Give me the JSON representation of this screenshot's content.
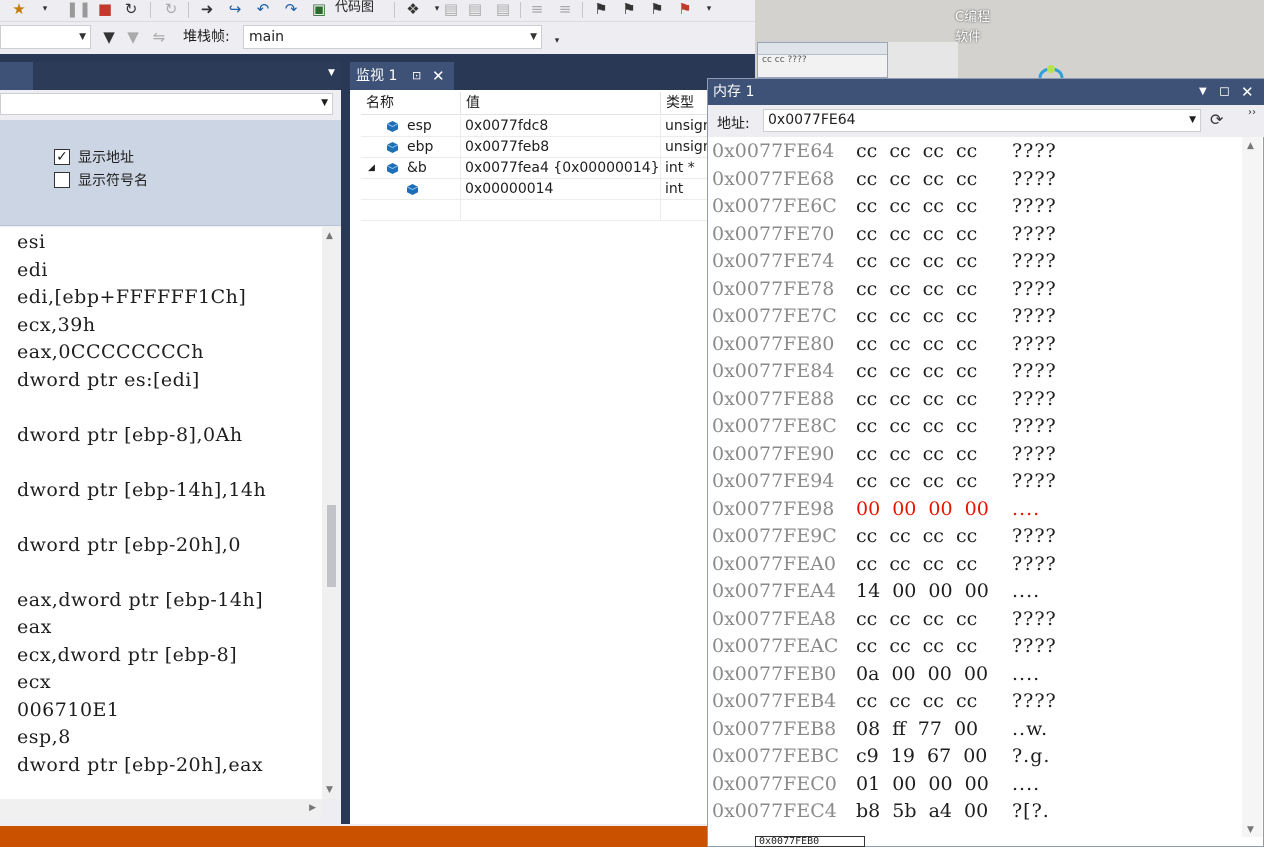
{
  "toolbar": {
    "codemap_label": "代码图"
  },
  "stackframe": {
    "label": "堆栈帧:",
    "value": "main"
  },
  "options": {
    "show_address": {
      "label": "显示地址",
      "checked": true
    },
    "show_symbol_names": {
      "label": "显示符号名",
      "checked": false
    }
  },
  "disassembly": {
    "lines": [
      "esi",
      "edi",
      "edi,[ebp+FFFFFF1Ch]",
      "ecx,39h",
      "eax,0CCCCCCCCh",
      "dword ptr es:[edi]",
      "",
      "dword ptr [ebp-8],0Ah",
      "",
      "dword ptr [ebp-14h],14h",
      "",
      "dword ptr [ebp-20h],0",
      "",
      "eax,dword ptr [ebp-14h]",
      "eax",
      "ecx,dword ptr [ebp-8]",
      "ecx",
      "006710E1",
      "esp,8",
      "dword ptr [ebp-20h],eax"
    ]
  },
  "watch": {
    "tab_label": "监视 1",
    "columns": {
      "name": "名称",
      "value": "值",
      "type": "类型"
    },
    "rows": [
      {
        "name": "esp",
        "value": "0x0077fdc8",
        "type": "unsign"
      },
      {
        "name": "ebp",
        "value": "0x0077feb8",
        "type": "unsign"
      },
      {
        "name": "&b",
        "value": "0x0077fea4 {0x00000014}",
        "type": "int *"
      },
      {
        "name": "",
        "value": "0x00000014",
        "type": "int"
      }
    ]
  },
  "memory": {
    "title": "内存 1",
    "address_label": "地址:",
    "address_value": "0x0077FE64",
    "rows": [
      {
        "addr": "0x0077FE64",
        "bytes": "cc cc cc cc",
        "text": "????",
        "changed": false
      },
      {
        "addr": "0x0077FE68",
        "bytes": "cc cc cc cc",
        "text": "????",
        "changed": false
      },
      {
        "addr": "0x0077FE6C",
        "bytes": "cc cc cc cc",
        "text": "????",
        "changed": false
      },
      {
        "addr": "0x0077FE70",
        "bytes": "cc cc cc cc",
        "text": "????",
        "changed": false
      },
      {
        "addr": "0x0077FE74",
        "bytes": "cc cc cc cc",
        "text": "????",
        "changed": false
      },
      {
        "addr": "0x0077FE78",
        "bytes": "cc cc cc cc",
        "text": "????",
        "changed": false
      },
      {
        "addr": "0x0077FE7C",
        "bytes": "cc cc cc cc",
        "text": "????",
        "changed": false
      },
      {
        "addr": "0x0077FE80",
        "bytes": "cc cc cc cc",
        "text": "????",
        "changed": false
      },
      {
        "addr": "0x0077FE84",
        "bytes": "cc cc cc cc",
        "text": "????",
        "changed": false
      },
      {
        "addr": "0x0077FE88",
        "bytes": "cc cc cc cc",
        "text": "????",
        "changed": false
      },
      {
        "addr": "0x0077FE8C",
        "bytes": "cc cc cc cc",
        "text": "????",
        "changed": false
      },
      {
        "addr": "0x0077FE90",
        "bytes": "cc cc cc cc",
        "text": "????",
        "changed": false
      },
      {
        "addr": "0x0077FE94",
        "bytes": "cc cc cc cc",
        "text": "????",
        "changed": false
      },
      {
        "addr": "0x0077FE98",
        "bytes": "00 00 00 00",
        "text": "....",
        "changed": true
      },
      {
        "addr": "0x0077FE9C",
        "bytes": "cc cc cc cc",
        "text": "????",
        "changed": false
      },
      {
        "addr": "0x0077FEA0",
        "bytes": "cc cc cc cc",
        "text": "????",
        "changed": false
      },
      {
        "addr": "0x0077FEA4",
        "bytes": "14 00 00 00",
        "text": "....",
        "changed": false
      },
      {
        "addr": "0x0077FEA8",
        "bytes": "cc cc cc cc",
        "text": "????",
        "changed": false
      },
      {
        "addr": "0x0077FEAC",
        "bytes": "cc cc cc cc",
        "text": "????",
        "changed": false
      },
      {
        "addr": "0x0077FEB0",
        "bytes": "0a 00 00 00",
        "text": "....",
        "changed": false
      },
      {
        "addr": "0x0077FEB4",
        "bytes": "cc cc cc cc",
        "text": "????",
        "changed": false
      },
      {
        "addr": "0x0077FEB8",
        "bytes": "08 ff 77 00",
        "text": "..w.",
        "changed": false
      },
      {
        "addr": "0x0077FEBC",
        "bytes": "c9 19 67 00",
        "text": "?.g.",
        "changed": false
      },
      {
        "addr": "0x0077FEC0",
        "bytes": "01 00 00 00",
        "text": "....",
        "changed": false
      },
      {
        "addr": "0x0077FEC4",
        "bytes": "b8 5b a4 00",
        "text": "?[?.",
        "changed": false
      }
    ]
  },
  "desktop": {
    "label_line1": "C编程",
    "label_line2": "软件",
    "mini_text": "cc cc ????",
    "bottom_text": "0x0077FEB0"
  },
  "colors": {
    "vs_dark": "#293955",
    "tab_active": "#3e5278",
    "changed_red": "#e51400",
    "status_orange": "#ca5100"
  }
}
